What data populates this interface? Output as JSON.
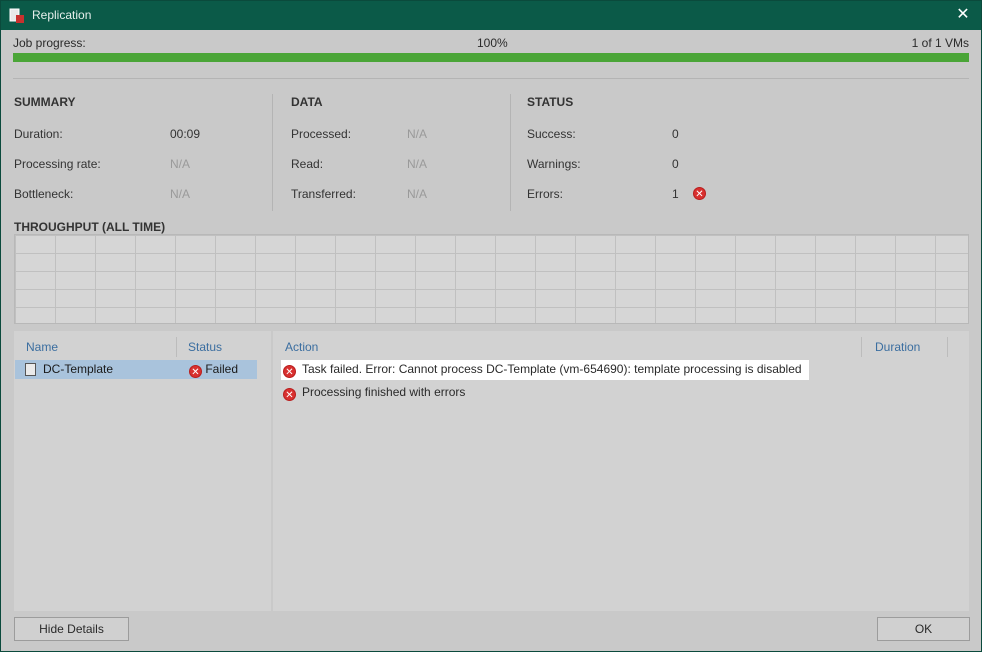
{
  "window": {
    "title": "Replication",
    "close_glyph": "✕"
  },
  "progress": {
    "label": "Job progress:",
    "percent_text": "100%",
    "count_text": "1 of 1 VMs",
    "fraction": 1.0
  },
  "summary": {
    "title": "SUMMARY",
    "duration_label": "Duration:",
    "duration_value": "00:09",
    "rate_label": "Processing rate:",
    "rate_value": "N/A",
    "bottleneck_label": "Bottleneck:",
    "bottleneck_value": "N/A"
  },
  "data": {
    "title": "DATA",
    "processed_label": "Processed:",
    "processed_value": "N/A",
    "read_label": "Read:",
    "read_value": "N/A",
    "transferred_label": "Transferred:",
    "transferred_value": "N/A"
  },
  "status": {
    "title": "STATUS",
    "success_label": "Success:",
    "success_value": "0",
    "warnings_label": "Warnings:",
    "warnings_value": "0",
    "errors_label": "Errors:",
    "errors_value": "1"
  },
  "throughput": {
    "title": "THROUGHPUT (ALL TIME)"
  },
  "vm_list": {
    "col_name": "Name",
    "col_status": "Status",
    "rows": [
      {
        "name": "DC-Template",
        "status": "Failed"
      }
    ]
  },
  "log": {
    "col_action": "Action",
    "col_duration": "Duration",
    "lines": [
      "Task failed. Error: Cannot process DC-Template (vm-654690): template processing is disabled",
      "Processing finished with errors"
    ]
  },
  "buttons": {
    "hide_details": "Hide Details",
    "ok": "OK"
  },
  "colors": {
    "title_bar": "#0b5a48",
    "progress": "#4aa537",
    "error": "#d8302f",
    "selection": "#a9c3dc"
  },
  "icons": {
    "app": "replication-app-icon",
    "error": "error-x-icon",
    "vm": "vm-template-icon"
  }
}
